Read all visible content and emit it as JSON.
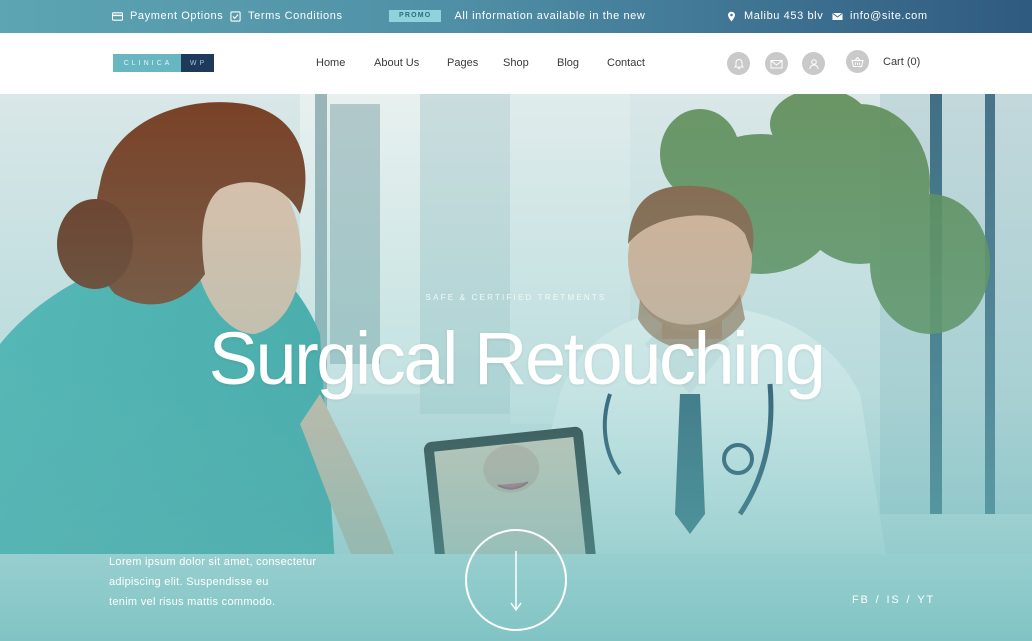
{
  "topbar": {
    "payment_label": "Payment Options",
    "terms_label": "Terms Conditions",
    "promo_badge": "PROMO",
    "promo_text": "All information available in the new",
    "address": "Malibu 453 blv",
    "email": "info@site.com",
    "icons": [
      "credit-card-icon",
      "checkbox-icon",
      "map-pin-icon",
      "mail-icon"
    ]
  },
  "logo": {
    "part1": "CLINICA",
    "part2": "WP"
  },
  "nav": {
    "items": [
      "Home",
      "About Us",
      "Pages",
      "Shop",
      "Blog",
      "Contact"
    ],
    "icons": [
      "bell-icon",
      "envelope-icon",
      "user-icon",
      "basket-icon"
    ],
    "cart_label": "Cart (0)"
  },
  "hero": {
    "kicker": "SAFE & CERTIFIED TRETMENTS",
    "title": "Surgical Retouching",
    "text_lines": [
      "Lorem ipsum dolor sit amet, consectetur",
      "adipiscing elit. Suspendisse eu",
      "tenim vel risus mattis commodo."
    ],
    "social": [
      "FB",
      "IS",
      "YT"
    ],
    "social_sep": "/"
  },
  "colors": {
    "topbar_start": "#5da5b2",
    "topbar_end": "#2f5a80",
    "logo_teal": "#69b6c3",
    "logo_navy": "#1e3a5a",
    "hero_tint": "#6ec0c0"
  }
}
